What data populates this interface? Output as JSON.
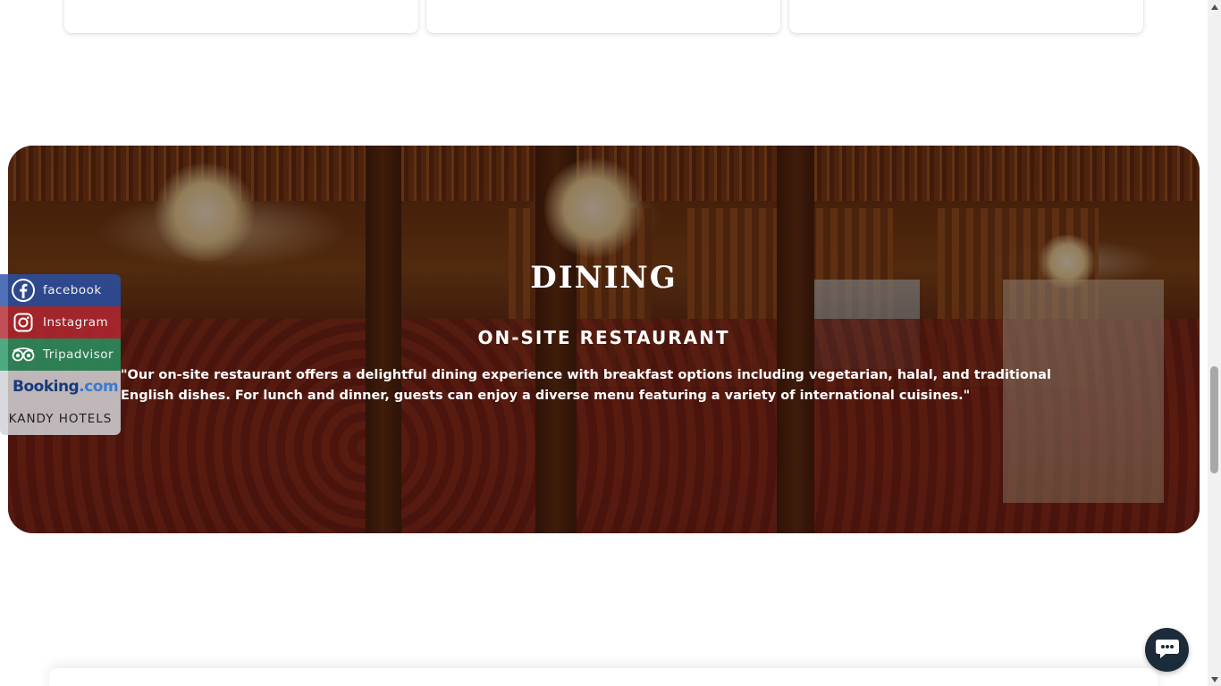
{
  "dining": {
    "title": "DINING",
    "subtitle": "ON-SITE RESTAURANT",
    "description": "\"Our on-site restaurant offers a delightful dining experience with breakfast options including vegetarian, halal, and traditional English dishes. For lunch and dinner, guests can enjoy a diverse menu featuring a variety of international cuisines.\""
  },
  "social": {
    "facebook_label": "facebook",
    "instagram_label": "Instagram",
    "tripadvisor_label": "Tripadvisor",
    "booking_label_main": "Booking",
    "booking_label_dot": ".com",
    "kandy_label": "KANDY HOTELS"
  },
  "colors": {
    "facebook": "#2850aa",
    "instagram": "#b42832",
    "tripadvisor": "#289664",
    "chat_button": "#1b2b3a"
  },
  "icons": {
    "facebook": "facebook-icon",
    "instagram": "instagram-icon",
    "tripadvisor": "tripadvisor-icon",
    "chat": "chat-icon"
  }
}
